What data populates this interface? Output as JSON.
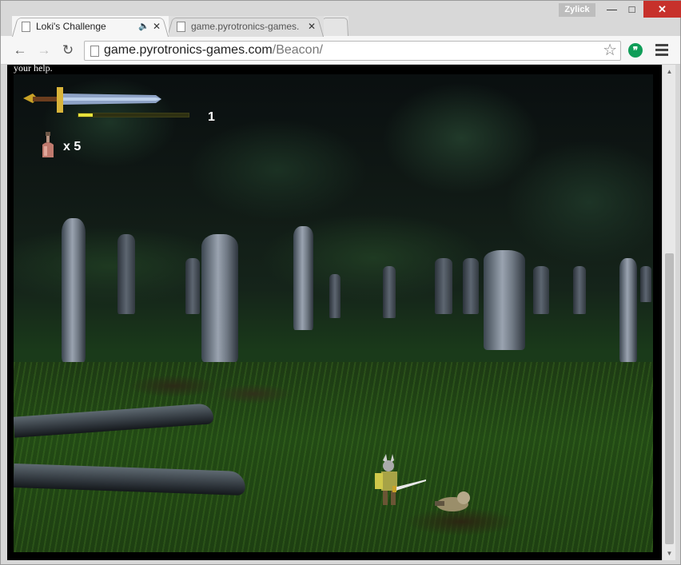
{
  "window": {
    "user_badge": "Zylick",
    "minimize_icon": "minimize-icon",
    "maximize_icon": "maximize-icon",
    "close_icon": "close-icon"
  },
  "tabs": [
    {
      "label": "Loki's Challenge",
      "active": true,
      "audio_icon": "speaker-icon"
    },
    {
      "label": "game.pyrotronics-games.c",
      "active": false
    }
  ],
  "toolbar": {
    "back_icon": "←",
    "forward_icon": "→",
    "reload_icon": "↻",
    "url_host": "game.pyrotronics-games.com",
    "url_path": "/Beacon/",
    "star_icon": "☆",
    "extension_icon": "❞"
  },
  "page": {
    "top_text": "your help."
  },
  "hud": {
    "level": "1",
    "xp_fraction": 0.13,
    "potion_count": "x 5"
  },
  "colors": {
    "xp_fill": "#e8e23a",
    "close_button": "#c7312b"
  }
}
